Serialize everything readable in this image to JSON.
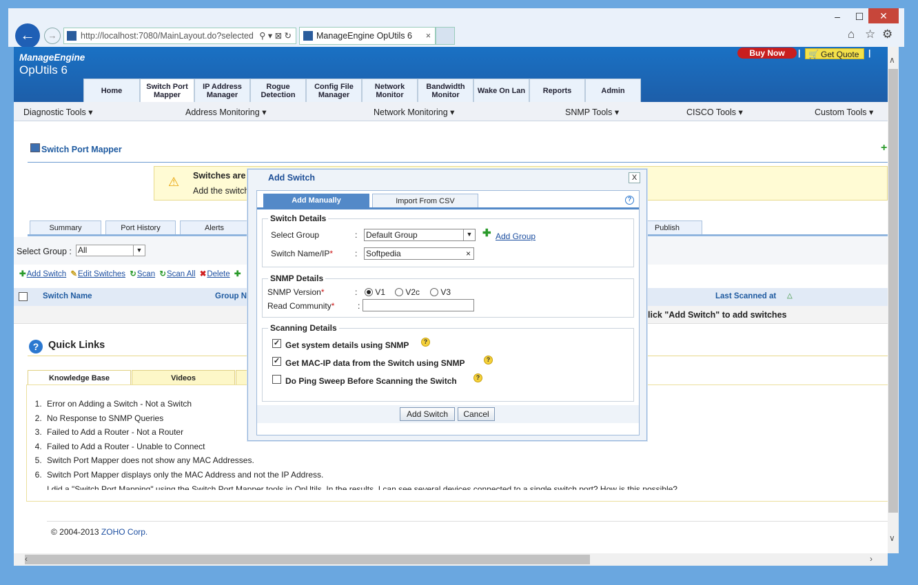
{
  "browser": {
    "url": "http://localhost:7080/MainLayout.do?selected",
    "tab_title": "ManageEngine OpUtils 6",
    "tab_close": "×",
    "min": "–",
    "max": "☐",
    "close": "✕"
  },
  "header": {
    "brand": "ManageEngine",
    "product": "OpUtils 6",
    "buy_now": "Buy Now",
    "get_quote": "Get Quote",
    "sep": "|"
  },
  "main_tabs": [
    {
      "label": "Home"
    },
    {
      "label": "Switch Port Mapper"
    },
    {
      "label": "IP Address Manager"
    },
    {
      "label": "Rogue Detection"
    },
    {
      "label": "Config File Manager"
    },
    {
      "label": "Network Monitor"
    },
    {
      "label": "Bandwidth Monitor"
    },
    {
      "label": "Wake On Lan"
    },
    {
      "label": "Reports"
    },
    {
      "label": "Admin"
    }
  ],
  "submenu": [
    "Diagnostic Tools",
    "Address Monitoring",
    "Network Monitoring",
    "SNMP Tools",
    "CISCO Tools",
    "Custom Tools"
  ],
  "page": {
    "title": "Switch Port Mapper",
    "warning_title": "Switches are",
    "warning_text": "Add the switch",
    "sub_tabs": [
      "Summary",
      "Port History",
      "Alerts",
      "Publish"
    ],
    "group_label": "Select Group :",
    "group_value": "All",
    "actions": [
      "Add Switch",
      "Edit Switches",
      "Scan",
      "Scan All",
      "Delete"
    ],
    "col_switch_name": "Switch Name",
    "col_group": "Group Na",
    "col_last_scanned": "Last Scanned at",
    "empty_message": "lick \"Add Switch\" to add switches"
  },
  "quick_links": {
    "title": "Quick Links",
    "tabs": [
      "Knowledge Base",
      "Videos"
    ],
    "items": [
      "Error on Adding a Switch - Not a Switch",
      "No Response to SNMP Queries",
      "Failed to Add a Router - Not a Router",
      "Failed to Add a Router - Unable to Connect",
      "Switch Port Mapper does not show any MAC Addresses.",
      "Switch Port Mapper displays only the MAC Address and not the IP Address.",
      "I did a \"Switch Port Mapping\" using the Switch Port Mapper tools in OpUtils. In the results, I can see several devices connected to a single switch port? How is this possible?"
    ]
  },
  "footer": {
    "copyright": "© 2004-2013",
    "company": "ZOHO Corp."
  },
  "modal": {
    "title": "Add Switch",
    "close": "X",
    "tab_manual": "Add Manually",
    "tab_csv": "Import From CSV",
    "help": "?",
    "switch_details": {
      "legend": "Switch Details",
      "group_label": "Select Group",
      "group_value": "Default Group",
      "add_group": "Add Group",
      "name_label": "Switch Name/IP",
      "name_value": "Softpedia",
      "clear": "×"
    },
    "snmp_details": {
      "legend": "SNMP Details",
      "version_label": "SNMP Version",
      "versions": [
        "V1",
        "V2c",
        "V3"
      ],
      "selected_version": "V1",
      "community_label": "Read Community",
      "community_value": ""
    },
    "scanning_details": {
      "legend": "Scanning Details",
      "options": [
        {
          "label": "Get system details using SNMP",
          "checked": true
        },
        {
          "label": "Get MAC-IP data from the Switch using SNMP",
          "checked": true
        },
        {
          "label": "Do Ping Sweep Before Scanning the Switch",
          "checked": false
        }
      ]
    },
    "add_button": "Add Switch",
    "cancel_button": "Cancel",
    "colon": ":",
    "required": "*"
  }
}
